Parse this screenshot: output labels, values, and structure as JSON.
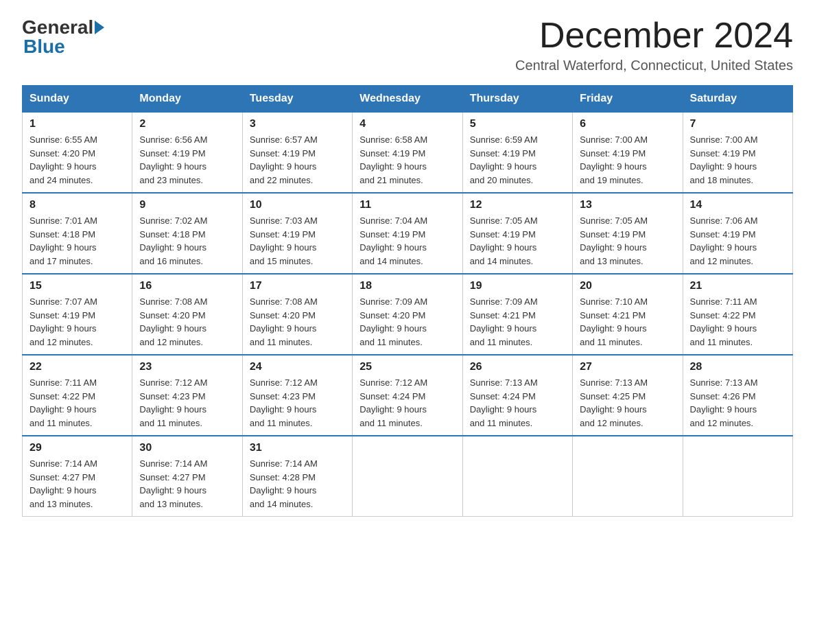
{
  "header": {
    "logo_general": "General",
    "logo_blue": "Blue",
    "month_title": "December 2024",
    "location": "Central Waterford, Connecticut, United States"
  },
  "days_of_week": [
    "Sunday",
    "Monday",
    "Tuesday",
    "Wednesday",
    "Thursday",
    "Friday",
    "Saturday"
  ],
  "weeks": [
    [
      {
        "day": "1",
        "sunrise": "6:55 AM",
        "sunset": "4:20 PM",
        "daylight": "9 hours and 24 minutes."
      },
      {
        "day": "2",
        "sunrise": "6:56 AM",
        "sunset": "4:19 PM",
        "daylight": "9 hours and 23 minutes."
      },
      {
        "day": "3",
        "sunrise": "6:57 AM",
        "sunset": "4:19 PM",
        "daylight": "9 hours and 22 minutes."
      },
      {
        "day": "4",
        "sunrise": "6:58 AM",
        "sunset": "4:19 PM",
        "daylight": "9 hours and 21 minutes."
      },
      {
        "day": "5",
        "sunrise": "6:59 AM",
        "sunset": "4:19 PM",
        "daylight": "9 hours and 20 minutes."
      },
      {
        "day": "6",
        "sunrise": "7:00 AM",
        "sunset": "4:19 PM",
        "daylight": "9 hours and 19 minutes."
      },
      {
        "day": "7",
        "sunrise": "7:00 AM",
        "sunset": "4:19 PM",
        "daylight": "9 hours and 18 minutes."
      }
    ],
    [
      {
        "day": "8",
        "sunrise": "7:01 AM",
        "sunset": "4:18 PM",
        "daylight": "9 hours and 17 minutes."
      },
      {
        "day": "9",
        "sunrise": "7:02 AM",
        "sunset": "4:18 PM",
        "daylight": "9 hours and 16 minutes."
      },
      {
        "day": "10",
        "sunrise": "7:03 AM",
        "sunset": "4:19 PM",
        "daylight": "9 hours and 15 minutes."
      },
      {
        "day": "11",
        "sunrise": "7:04 AM",
        "sunset": "4:19 PM",
        "daylight": "9 hours and 14 minutes."
      },
      {
        "day": "12",
        "sunrise": "7:05 AM",
        "sunset": "4:19 PM",
        "daylight": "9 hours and 14 minutes."
      },
      {
        "day": "13",
        "sunrise": "7:05 AM",
        "sunset": "4:19 PM",
        "daylight": "9 hours and 13 minutes."
      },
      {
        "day": "14",
        "sunrise": "7:06 AM",
        "sunset": "4:19 PM",
        "daylight": "9 hours and 12 minutes."
      }
    ],
    [
      {
        "day": "15",
        "sunrise": "7:07 AM",
        "sunset": "4:19 PM",
        "daylight": "9 hours and 12 minutes."
      },
      {
        "day": "16",
        "sunrise": "7:08 AM",
        "sunset": "4:20 PM",
        "daylight": "9 hours and 12 minutes."
      },
      {
        "day": "17",
        "sunrise": "7:08 AM",
        "sunset": "4:20 PM",
        "daylight": "9 hours and 11 minutes."
      },
      {
        "day": "18",
        "sunrise": "7:09 AM",
        "sunset": "4:20 PM",
        "daylight": "9 hours and 11 minutes."
      },
      {
        "day": "19",
        "sunrise": "7:09 AM",
        "sunset": "4:21 PM",
        "daylight": "9 hours and 11 minutes."
      },
      {
        "day": "20",
        "sunrise": "7:10 AM",
        "sunset": "4:21 PM",
        "daylight": "9 hours and 11 minutes."
      },
      {
        "day": "21",
        "sunrise": "7:11 AM",
        "sunset": "4:22 PM",
        "daylight": "9 hours and 11 minutes."
      }
    ],
    [
      {
        "day": "22",
        "sunrise": "7:11 AM",
        "sunset": "4:22 PM",
        "daylight": "9 hours and 11 minutes."
      },
      {
        "day": "23",
        "sunrise": "7:12 AM",
        "sunset": "4:23 PM",
        "daylight": "9 hours and 11 minutes."
      },
      {
        "day": "24",
        "sunrise": "7:12 AM",
        "sunset": "4:23 PM",
        "daylight": "9 hours and 11 minutes."
      },
      {
        "day": "25",
        "sunrise": "7:12 AM",
        "sunset": "4:24 PM",
        "daylight": "9 hours and 11 minutes."
      },
      {
        "day": "26",
        "sunrise": "7:13 AM",
        "sunset": "4:24 PM",
        "daylight": "9 hours and 11 minutes."
      },
      {
        "day": "27",
        "sunrise": "7:13 AM",
        "sunset": "4:25 PM",
        "daylight": "9 hours and 12 minutes."
      },
      {
        "day": "28",
        "sunrise": "7:13 AM",
        "sunset": "4:26 PM",
        "daylight": "9 hours and 12 minutes."
      }
    ],
    [
      {
        "day": "29",
        "sunrise": "7:14 AM",
        "sunset": "4:27 PM",
        "daylight": "9 hours and 13 minutes."
      },
      {
        "day": "30",
        "sunrise": "7:14 AM",
        "sunset": "4:27 PM",
        "daylight": "9 hours and 13 minutes."
      },
      {
        "day": "31",
        "sunrise": "7:14 AM",
        "sunset": "4:28 PM",
        "daylight": "9 hours and 14 minutes."
      },
      null,
      null,
      null,
      null
    ]
  ]
}
